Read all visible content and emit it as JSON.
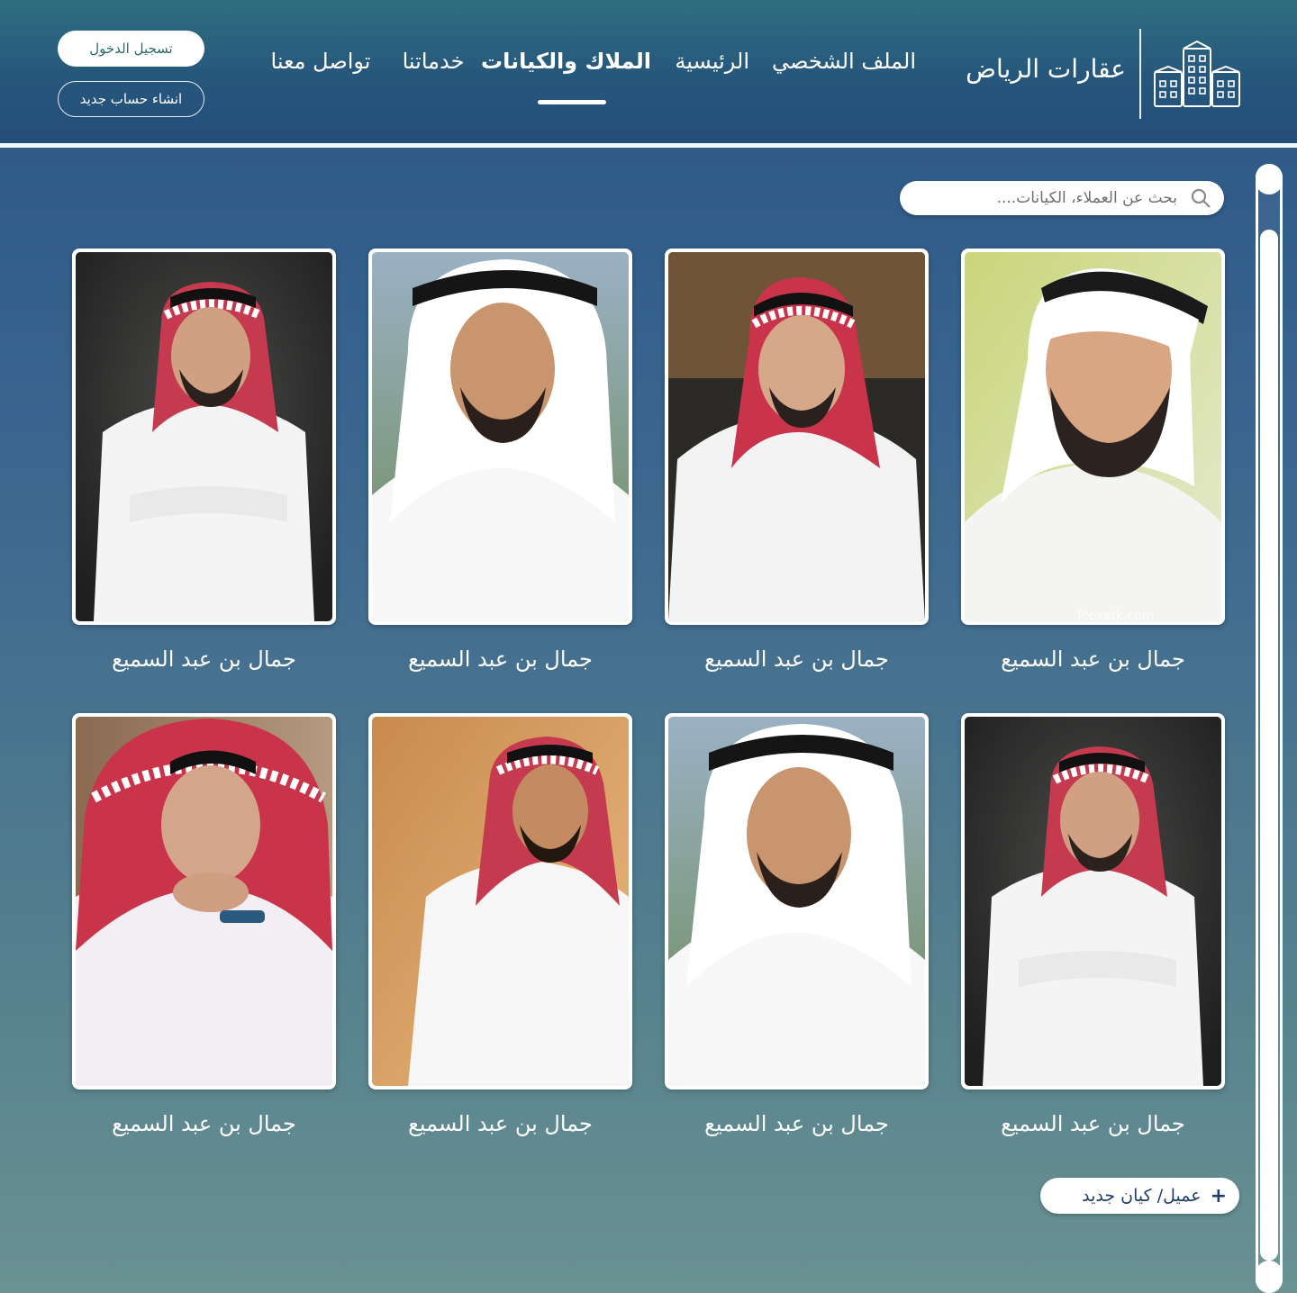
{
  "header": {
    "brand_name": "عقارات الرياض",
    "nav": [
      {
        "label": "الملف الشخصي",
        "active": false
      },
      {
        "label": "الرئيسية",
        "active": false
      },
      {
        "label": "الملاك والكيانات",
        "active": true
      },
      {
        "label": "خدماتنا",
        "active": false
      },
      {
        "label": "تواصل معنا",
        "active": false
      }
    ],
    "login_label": "تسجيل الدخول",
    "register_label": "انشاء حساب جديد"
  },
  "search": {
    "placeholder": "بحث عن العملاء، الكيانات...."
  },
  "cards": [
    {
      "name": "جمال بن عبد السميع",
      "photo_watermark": "Mexatk.com"
    },
    {
      "name": "جمال بن عبد السميع"
    },
    {
      "name": "جمال بن عبد السميع"
    },
    {
      "name": "جمال بن عبد السميع"
    },
    {
      "name": "جمال بن عبد السميع"
    },
    {
      "name": "جمال بن عبد السميع"
    },
    {
      "name": "جمال بن عبد السميع"
    },
    {
      "name": "جمال بن عبد السميع"
    }
  ],
  "add_button": {
    "label": "عميل/ كيان جديد",
    "icon": "plus-icon"
  },
  "colors": {
    "header": "#26567c",
    "accent_text": "#1f3f6e",
    "login_text": "#2a6a6a"
  }
}
